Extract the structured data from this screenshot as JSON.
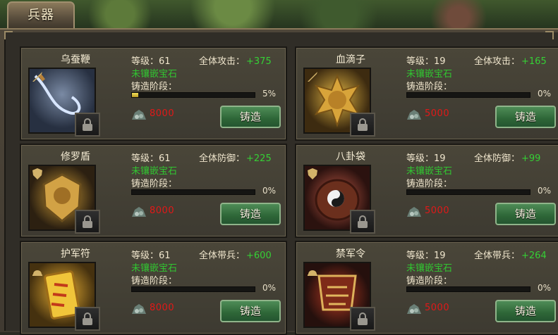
{
  "tab": {
    "label": "兵器"
  },
  "labels": {
    "level_prefix": "等级：",
    "stage": "铸造阶段：",
    "gem": "未镶嵌宝石",
    "forge": "铸造"
  },
  "items": [
    {
      "name": "乌蚕鞭",
      "level": "61",
      "stat": "全体攻击：",
      "bonus": "+375",
      "cost": "8000",
      "progress_pct": 5,
      "progress_text": "5%",
      "portrait_colors": [
        "#6e7c90",
        "#262e3c"
      ],
      "icon": "sword-icon"
    },
    {
      "name": "血滴子",
      "level": "19",
      "stat": "全体攻击：",
      "bonus": "+165",
      "cost": "5000",
      "progress_pct": 0,
      "progress_text": "0%",
      "portrait_colors": [
        "#d1a02e",
        "#3c2b10"
      ],
      "icon": "sword-icon"
    },
    {
      "name": "修罗盾",
      "level": "61",
      "stat": "全体防御：",
      "bonus": "+225",
      "cost": "8000",
      "progress_pct": 0,
      "progress_text": "0%",
      "portrait_colors": [
        "#c18f2f",
        "#3a2a14"
      ],
      "icon": "shield-icon"
    },
    {
      "name": "八卦袋",
      "level": "19",
      "stat": "全体防御：",
      "bonus": "+99",
      "cost": "5000",
      "progress_pct": 0,
      "progress_text": "0%",
      "portrait_colors": [
        "#b24f3c",
        "#3a1813"
      ],
      "icon": "shield-icon"
    },
    {
      "name": "护军符",
      "level": "61",
      "stat": "全体带兵：",
      "bonus": "+600",
      "cost": "8000",
      "progress_pct": 0,
      "progress_text": "0%",
      "portrait_colors": [
        "#e2a726",
        "#4a3514"
      ],
      "icon": "helmet-icon"
    },
    {
      "name": "禁军令",
      "level": "19",
      "stat": "全体带兵：",
      "bonus": "+264",
      "cost": "5000",
      "progress_pct": 0,
      "progress_text": "0%",
      "portrait_colors": [
        "#a52e1c",
        "#2a0d09"
      ],
      "icon": "helmet-icon"
    }
  ]
}
